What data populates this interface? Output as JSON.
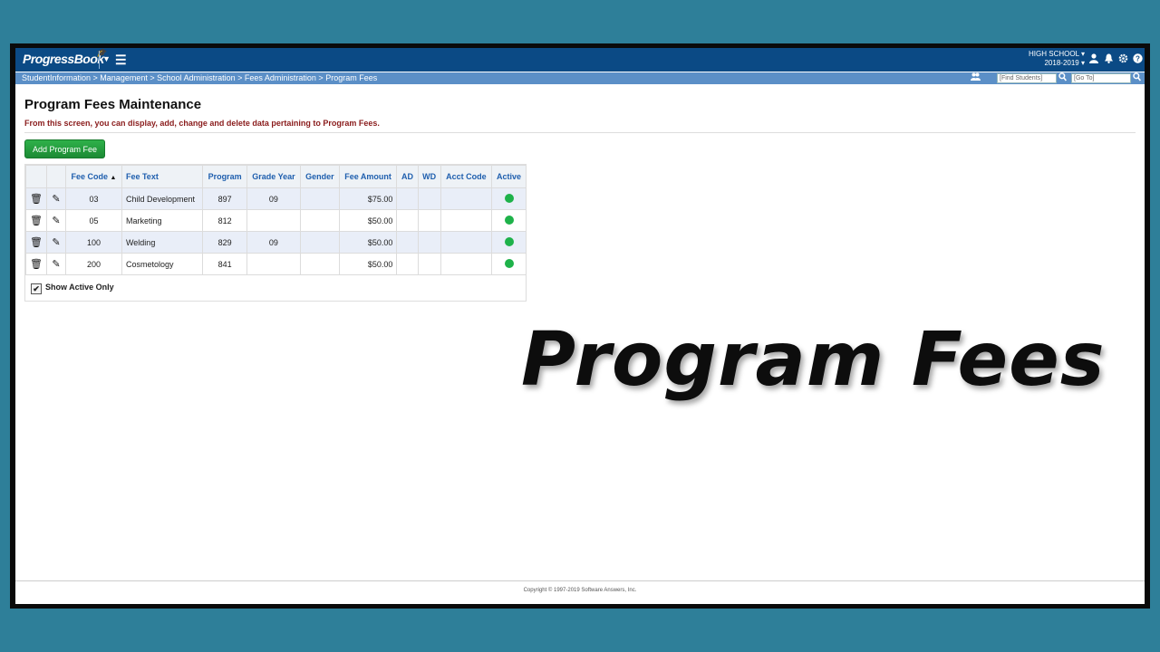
{
  "header": {
    "logo": "ProgressBook",
    "school": "HIGH SCHOOL",
    "year": "2018-2019",
    "icons": [
      "user-icon",
      "bell-icon",
      "gear-icon",
      "help-icon"
    ]
  },
  "breadcrumb": {
    "path": "StudentInformation > Management > School Administration > Fees Administration > Program Fees",
    "find_students_placeholder": "[Find Students]",
    "goto_placeholder": "[Go To]"
  },
  "page": {
    "title": "Program Fees Maintenance",
    "description": "From this screen, you can display, add, change and delete data pertaining to Program Fees.",
    "add_button": "Add Program Fee"
  },
  "table": {
    "headers": [
      "Fee Code",
      "Fee Text",
      "Program",
      "Grade Year",
      "Gender",
      "Fee Amount",
      "AD",
      "WD",
      "Acct Code",
      "Active"
    ],
    "rows": [
      {
        "fee_code": "03",
        "fee_text": "Child Development",
        "program": "897",
        "grade_year": "09",
        "gender": "",
        "fee_amount": "$75.00",
        "ad": "",
        "wd": "",
        "acct_code": "",
        "active": true
      },
      {
        "fee_code": "05",
        "fee_text": "Marketing",
        "program": "812",
        "grade_year": "",
        "gender": "",
        "fee_amount": "$50.00",
        "ad": "",
        "wd": "",
        "acct_code": "",
        "active": true
      },
      {
        "fee_code": "100",
        "fee_text": "Welding",
        "program": "829",
        "grade_year": "09",
        "gender": "",
        "fee_amount": "$50.00",
        "ad": "",
        "wd": "",
        "acct_code": "",
        "active": true
      },
      {
        "fee_code": "200",
        "fee_text": "Cosmetology",
        "program": "841",
        "grade_year": "",
        "gender": "",
        "fee_amount": "$50.00",
        "ad": "",
        "wd": "",
        "acct_code": "",
        "active": true
      }
    ],
    "show_active_label": "Show Active Only",
    "show_active_checked": true
  },
  "footer": {
    "copyright": "Copyright © 1997-2019 Software Answers, Inc."
  },
  "overlay": {
    "title": "Program Fees"
  },
  "colors": {
    "header_bg": "#0b4a85",
    "breadcrumb_bg": "#5b8fc7",
    "button_green": "#1c8a34",
    "active_dot": "#1eb24a",
    "page_bg": "#2e7f99"
  }
}
